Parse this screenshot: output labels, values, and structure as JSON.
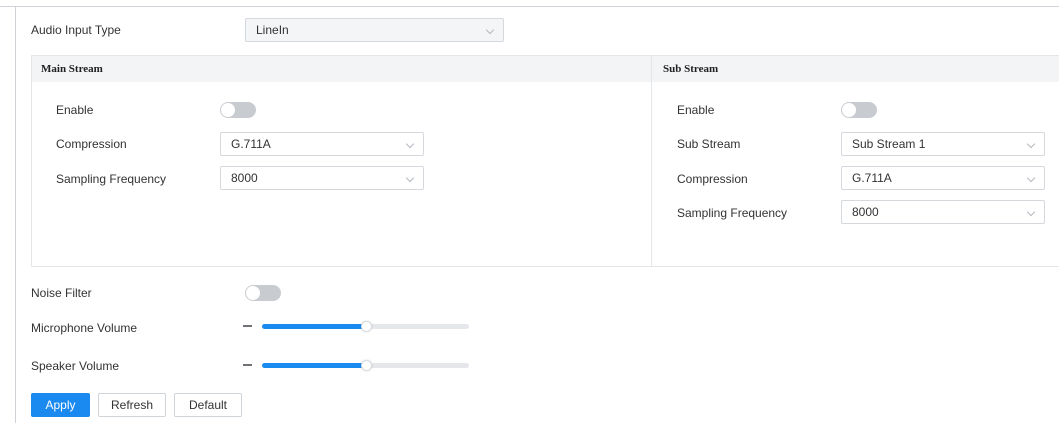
{
  "audio_input_type": {
    "label": "Audio Input Type",
    "value": "LineIn"
  },
  "main_stream": {
    "title": "Main Stream",
    "enable_label": "Enable",
    "enabled": false,
    "compression": {
      "label": "Compression",
      "value": "G.711A"
    },
    "sampling_frequency": {
      "label": "Sampling Frequency",
      "value": "8000"
    }
  },
  "sub_stream": {
    "title": "Sub Stream",
    "enable_label": "Enable",
    "enabled": false,
    "sub_stream": {
      "label": "Sub Stream",
      "value": "Sub Stream 1"
    },
    "compression": {
      "label": "Compression",
      "value": "G.711A"
    },
    "sampling_frequency": {
      "label": "Sampling Frequency",
      "value": "8000"
    }
  },
  "noise_filter": {
    "label": "Noise Filter",
    "enabled": false
  },
  "microphone_volume": {
    "label": "Microphone Volume",
    "level": 0.5
  },
  "speaker_volume": {
    "label": "Speaker Volume",
    "level": 0.5
  },
  "buttons": {
    "apply": "Apply",
    "refresh": "Refresh",
    "default": "Default"
  },
  "colors": {
    "accent": "#1a8af0",
    "toggle_off": "#c8cbd0"
  }
}
